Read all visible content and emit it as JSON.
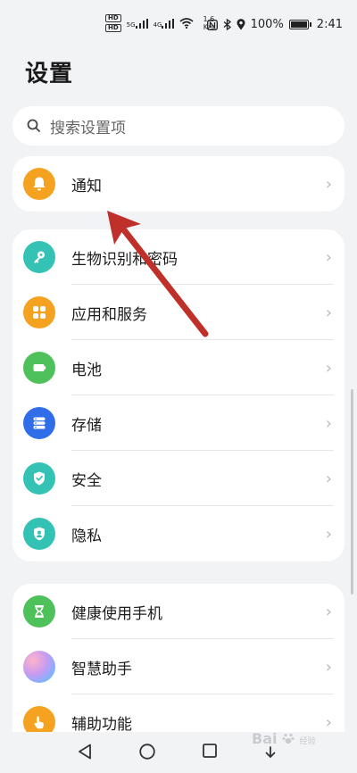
{
  "status_bar": {
    "hd1": "HD",
    "hd2": "HD",
    "sig1_tag": "5G",
    "sig2_tag": "4G",
    "speed_value": "1.6",
    "speed_unit": "K/s",
    "battery_percent": "100%",
    "time": "2:41",
    "icons": [
      "nfc-icon",
      "bluetooth-icon",
      "location-icon",
      "battery-icon"
    ]
  },
  "page_title": "设置",
  "search": {
    "placeholder": "搜索设置项"
  },
  "group1": [
    {
      "label": "通知",
      "icon": "bell-icon",
      "color": "#f4a21f"
    }
  ],
  "group2": [
    {
      "label": "生物识别和密码",
      "icon": "key-icon",
      "color": "#34c2b4"
    },
    {
      "label": "应用和服务",
      "icon": "apps-icon",
      "color": "#f4a21f"
    },
    {
      "label": "电池",
      "icon": "battery-icon",
      "color": "#4fc15b"
    },
    {
      "label": "存储",
      "icon": "storage-icon",
      "color": "#2f6ee8"
    },
    {
      "label": "安全",
      "icon": "shield-check-icon",
      "color": "#34c2b4"
    },
    {
      "label": "隐私",
      "icon": "privacy-icon",
      "color": "#34c2b4"
    }
  ],
  "group3": [
    {
      "label": "健康使用手机",
      "icon": "hourglass-icon",
      "color": "#4fc15b"
    },
    {
      "label": "智慧助手",
      "icon": "assistant-icon",
      "color": "#b58cf0"
    },
    {
      "label": "辅助功能",
      "icon": "hand-icon",
      "color": "#f4a21f"
    }
  ],
  "watermark": {
    "main": "Bai",
    "sub": "经验"
  },
  "annotation_color": "#c0302a"
}
